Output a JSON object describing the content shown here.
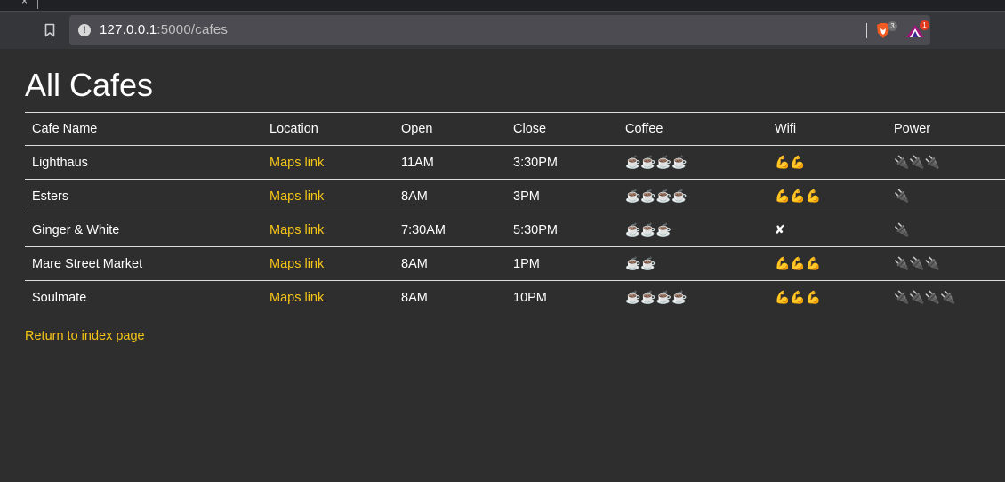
{
  "browser": {
    "tab_close_glyph": "×",
    "url_host": "127.0.0.1",
    "url_path": ":5000/cafes",
    "brave_badge": "3",
    "rewards_badge": "1"
  },
  "page": {
    "title": "All Cafes",
    "return_link": "Return to index page"
  },
  "table": {
    "headers": [
      "Cafe Name",
      "Location",
      "Open",
      "Close",
      "Coffee",
      "Wifi",
      "Power"
    ],
    "rows": [
      {
        "name": "Lighthaus",
        "location": "Maps link",
        "open": "11AM",
        "close": "3:30PM",
        "coffee": "☕☕☕☕",
        "wifi": "💪💪",
        "power": "🔌🔌🔌"
      },
      {
        "name": "Esters",
        "location": "Maps link",
        "open": "8AM",
        "close": "3PM",
        "coffee": "☕☕☕☕",
        "wifi": "💪💪💪",
        "power": "🔌"
      },
      {
        "name": "Ginger & White",
        "location": "Maps link",
        "open": "7:30AM",
        "close": "5:30PM",
        "coffee": "☕☕☕",
        "wifi": "✘",
        "power": "🔌"
      },
      {
        "name": "Mare Street Market",
        "location": "Maps link",
        "open": "8AM",
        "close": "1PM",
        "coffee": "☕☕",
        "wifi": "💪💪💪",
        "power": "🔌🔌🔌"
      },
      {
        "name": "Soulmate",
        "location": "Maps link",
        "open": "8AM",
        "close": "10PM",
        "coffee": "☕☕☕☕",
        "wifi": "💪💪💪",
        "power": "🔌🔌🔌🔌"
      }
    ]
  },
  "colors": {
    "background": "#2e2e2e",
    "accent": "#f5c518",
    "text": "#ffffff",
    "rule": "#dcdcdc"
  }
}
